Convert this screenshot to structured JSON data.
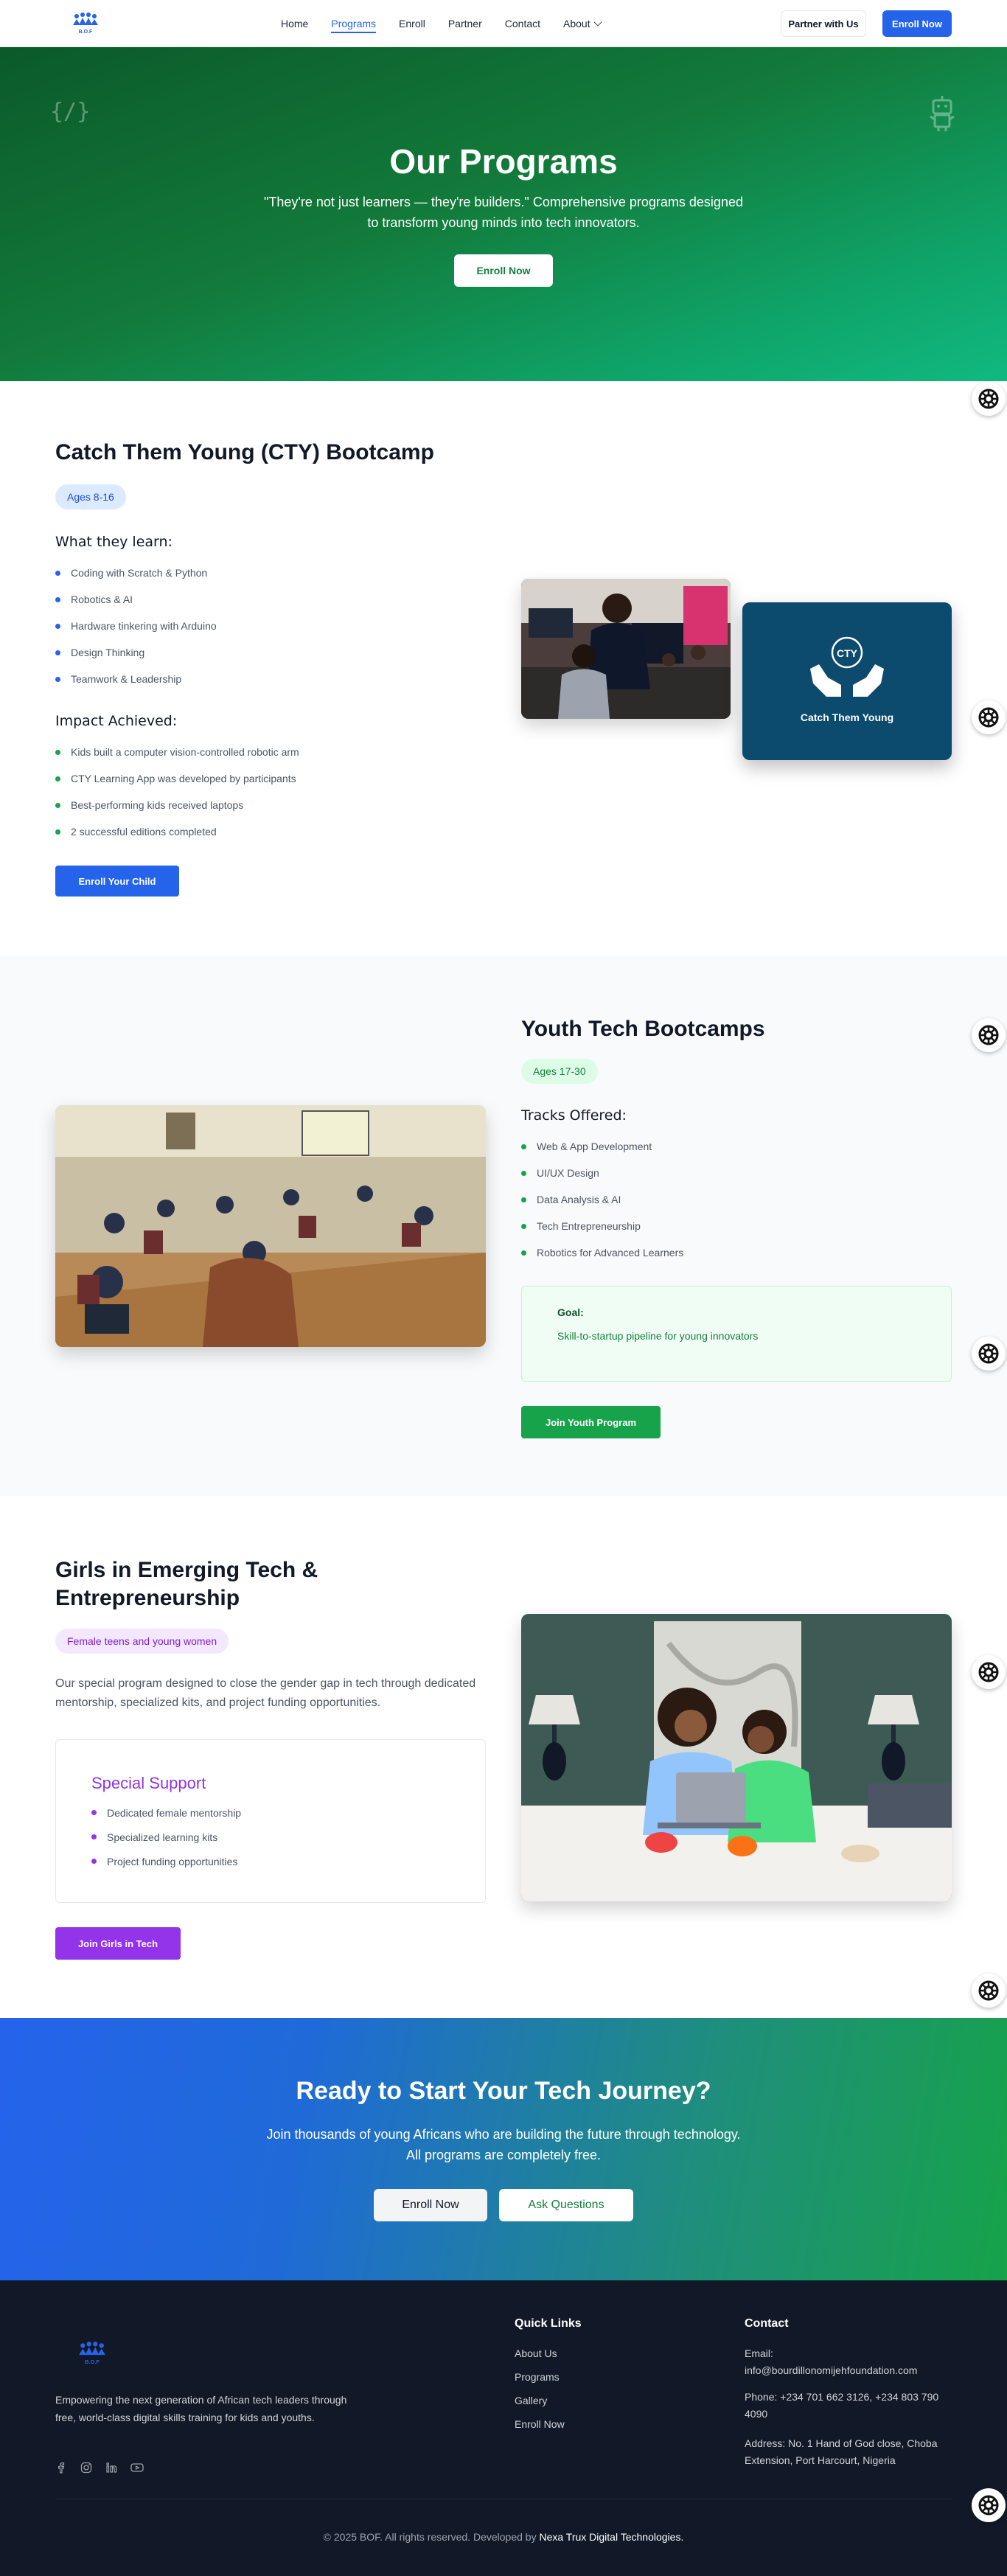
{
  "nav": {
    "logo_text": "B.O.F",
    "links": [
      "Home",
      "Programs",
      "Enroll",
      "Partner",
      "Contact",
      "About"
    ],
    "active": "Programs",
    "partner_btn": "Partner with Us",
    "enroll_btn": "Enroll Now"
  },
  "hero": {
    "title": "Our Programs",
    "subtitle": "\"They're not just learners — they're builders.\" Comprehensive programs designed to transform young minds into tech innovators.",
    "button": "Enroll Now",
    "code_glyph": "{/}"
  },
  "cty": {
    "title": "Catch Them Young (CTY) Bootcamp",
    "badge": "Ages 8-16",
    "learn_heading": "What they learn:",
    "learn_items": [
      "Coding with Scratch & Python",
      "Robotics & AI",
      "Hardware tinkering with Arduino",
      "Design Thinking",
      "Teamwork & Leadership"
    ],
    "impact_heading": "Impact Achieved:",
    "impact_items": [
      "Kids built a computer vision-controlled robotic arm",
      "CTY Learning App was developed by participants",
      "Best-performing kids received laptops",
      "2 successful editions completed"
    ],
    "button": "Enroll Your Child",
    "card_logo_text": "CTY",
    "card_label": "Catch Them Young"
  },
  "youth": {
    "title": "Youth Tech Bootcamps",
    "badge": "Ages 17-30",
    "tracks_heading": "Tracks Offered:",
    "tracks": [
      "Web & App Development",
      "UI/UX Design",
      "Data Analysis & AI",
      "Tech Entrepreneurship",
      "Robotics for Advanced Learners"
    ],
    "goal_label": "Goal:",
    "goal_text": "Skill-to-startup pipeline for young innovators",
    "button": "Join Youth Program"
  },
  "girls": {
    "title": "Girls in Emerging Tech & Entrepreneurship",
    "badge": "Female teens and young women",
    "description": "Our special program designed to close the gender gap in tech through dedicated mentorship, specialized kits, and project funding opportunities.",
    "support_heading": "Special Support",
    "support_items": [
      "Dedicated female mentorship",
      "Specialized learning kits",
      "Project funding opportunities"
    ],
    "button": "Join Girls in Tech"
  },
  "ready": {
    "title": "Ready to Start Your Tech Journey?",
    "subtitle": "Join thousands of young Africans who are building the future through technology. All programs are completely free.",
    "enroll_btn": "Enroll Now",
    "ask_btn": "Ask Questions"
  },
  "footer": {
    "logo_text": "B.O.F",
    "tagline": "Empowering the next generation of African tech leaders through free, world-class digital skills training for kids and youths.",
    "quick_heading": "Quick Links",
    "quick_links": [
      "About Us",
      "Programs",
      "Gallery",
      "Enroll Now"
    ],
    "contact_heading": "Contact",
    "email_label": "Email:",
    "email": "info@bourdillonomijehfoundation.com",
    "phone": "Phone: +234 701 662 3126, +234 803 790 4090",
    "address": "Address: No. 1 Hand of God close, Choba Extension, Port Harcourt, Nigeria",
    "copyright_prefix": "© 2025 BOF. All rights reserved. Developed by",
    "developer": "Nexa Trux Digital Technologies."
  },
  "colors": {
    "primary": "#2563eb",
    "green": "#16a34a",
    "purple": "#9333ea",
    "dark": "#111827"
  }
}
